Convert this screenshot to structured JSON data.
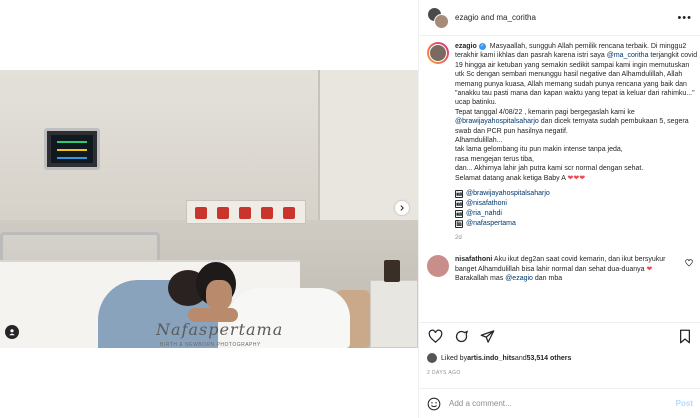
{
  "header": {
    "user1": "ezagio",
    "connector": " and ",
    "user2": "ma_coritha",
    "more": "•••"
  },
  "media": {
    "watermark": "Nafaspertama",
    "watermark_sub": "BIRTH & NEWBORN PHOTOGRAPHY"
  },
  "caption": {
    "username": "ezagio",
    "verified": "✓",
    "part1": " Masyaallah, sungguh Allah pemilik rencana terbaik. Di minggu2 terakhir kami ikhlas dan pasrah karena istri saya ",
    "mention1": "@ma_coritha",
    "part2": " terjangkit covid 19 hingga air ketuban yang semakin sedikit sampai kami ingin memutuskan utk Sc dengan sembari menunggu hasil negative dan Alhamdulillah, Allah memang punya kuasa, Allah memang sudah punya rencana yang baik dan \"anakku tau pasti mana dan kapan waktu yang tepat ia keluar dari rahimku...\" ucap batinku.\nTepat tanggal 4/08/22 , kemarin pagi bergegaslah kami ke ",
    "mention2": "@brawijayahospitalsaharjo",
    "part3": " dan dicek ternyata sudah pembukaan 5, segera swab dan PCR pun hasilnya negatif.\nAlhamdulillah...\ntak lama gelombang itu pun makin intense tanpa jeda,\nrasa mengejan terus tiba,\ndan... Akhirnya lahir jah putra kami scr normal dengan sehat.\nSelamat datang anak ketiga Baby A ",
    "hearts": "❤❤❤",
    "tags": [
      {
        "icon": "📷",
        "text": "@brawijayahospitalsaharjo"
      },
      {
        "icon": "📷",
        "text": "@nisafathoni"
      },
      {
        "icon": "📷",
        "text": "@ria_nahdi"
      },
      {
        "icon": "🎬",
        "text": "@nafaspertama"
      }
    ],
    "time": "2d"
  },
  "comment2": {
    "username": "nisafathoni",
    "text": " Aku ikut deg2an saat covid kemarin, dan ikut bersyukur banget Alhamdulillah bisa lahir normal dan sehat dua-duanya ",
    "heart": "❤",
    "text2": " Barakallah mas ",
    "mention": "@ezagio",
    "text3": " dan mba"
  },
  "likes": {
    "prefix": "Liked by ",
    "user": "artis.indo_hits",
    "middle": " and ",
    "count": "53,514 others"
  },
  "date": "2 DAYS AGO",
  "add_comment": {
    "placeholder": "Add a comment...",
    "post": "Post"
  },
  "colors": {
    "verified": "#3897f0",
    "mention": "#00376b",
    "heart": "#ed4956",
    "post_button": "#b3dbff"
  }
}
